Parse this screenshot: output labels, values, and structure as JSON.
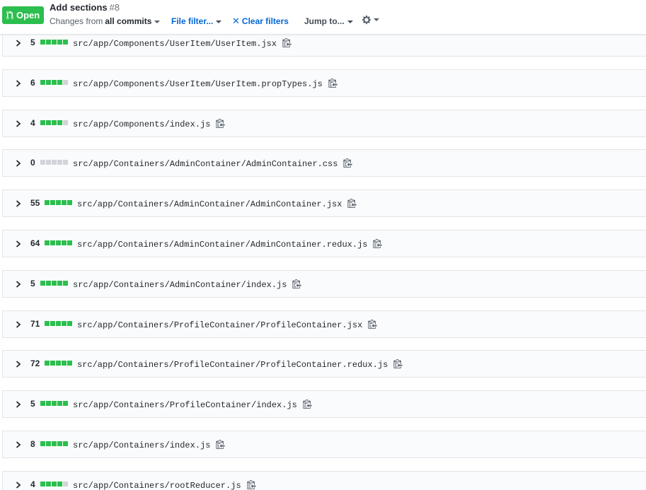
{
  "pr": {
    "state": "Open",
    "title": "Add sections",
    "number": "#8"
  },
  "toolbar": {
    "changes_from_label": "Changes from",
    "changes_from_value": "all commits",
    "file_filter_label": "File filter...",
    "clear_filters_label": "Clear filters",
    "jump_to_label": "Jump to...",
    "settings_icon": "gear-icon"
  },
  "colors": {
    "open_green": "#2cbe4e",
    "link_blue": "#0366d6",
    "diffstat_added": "#2cbe4e",
    "diffstat_neutral": "#d1d5da"
  },
  "files": [
    {
      "changes": "5",
      "path": "src/app/Components/UserItem/UserItem.jsx",
      "added_blocks": 5
    },
    {
      "changes": "6",
      "path": "src/app/Components/UserItem/UserItem.propTypes.js",
      "added_blocks": 4
    },
    {
      "changes": "4",
      "path": "src/app/Components/index.js",
      "added_blocks": 4
    },
    {
      "changes": "0",
      "path": "src/app/Containers/AdminContainer/AdminContainer.css",
      "added_blocks": 0
    },
    {
      "changes": "55",
      "path": "src/app/Containers/AdminContainer/AdminContainer.jsx",
      "added_blocks": 5
    },
    {
      "changes": "64",
      "path": "src/app/Containers/AdminContainer/AdminContainer.redux.js",
      "added_blocks": 5
    },
    {
      "changes": "5",
      "path": "src/app/Containers/AdminContainer/index.js",
      "added_blocks": 5
    },
    {
      "changes": "71",
      "path": "src/app/Containers/ProfileContainer/ProfileContainer.jsx",
      "added_blocks": 5
    },
    {
      "changes": "72",
      "path": "src/app/Containers/ProfileContainer/ProfileContainer.redux.js",
      "added_blocks": 5
    },
    {
      "changes": "5",
      "path": "src/app/Containers/ProfileContainer/index.js",
      "added_blocks": 5
    },
    {
      "changes": "8",
      "path": "src/app/Containers/index.js",
      "added_blocks": 5
    },
    {
      "changes": "4",
      "path": "src/app/Containers/rootReducer.js",
      "added_blocks": 4
    }
  ]
}
